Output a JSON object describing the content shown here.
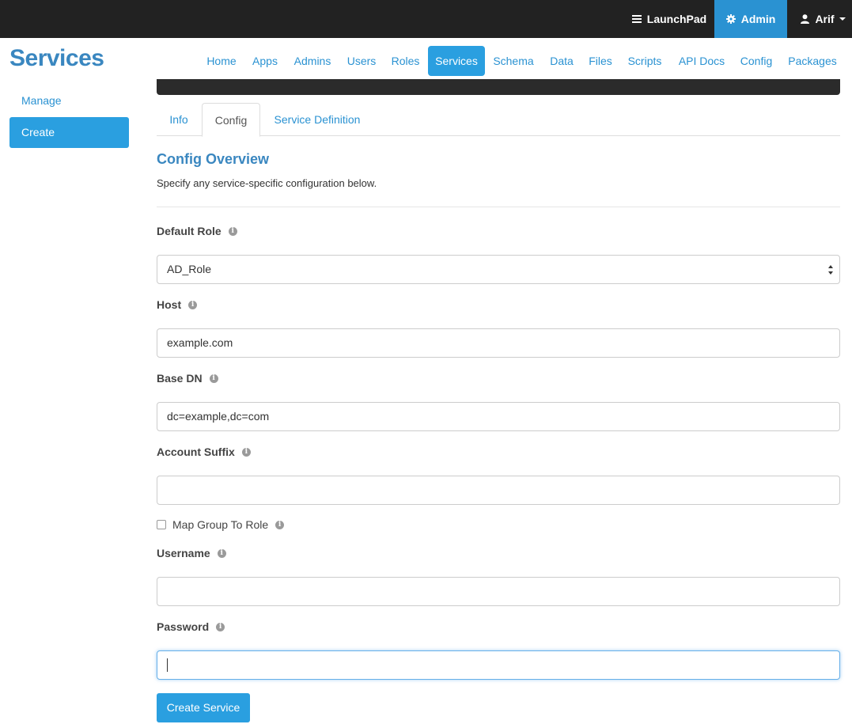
{
  "topbar": {
    "launchpad_label": "LaunchPad",
    "admin_label": "Admin",
    "user_label": "Arif"
  },
  "page_title": "Services",
  "nav": {
    "items": [
      {
        "label": "Home"
      },
      {
        "label": "Apps"
      },
      {
        "label": "Admins"
      },
      {
        "label": "Users"
      },
      {
        "label": "Roles"
      },
      {
        "label": "Services"
      },
      {
        "label": "Schema"
      },
      {
        "label": "Data"
      },
      {
        "label": "Files"
      },
      {
        "label": "Scripts"
      },
      {
        "label": "API Docs"
      },
      {
        "label": "Config"
      },
      {
        "label": "Packages"
      }
    ],
    "active": "Services"
  },
  "sidebar": {
    "manage_label": "Manage",
    "create_label": "Create"
  },
  "tabs": {
    "info": "Info",
    "config": "Config",
    "service_definition": "Service Definition",
    "active": "Config"
  },
  "config": {
    "title": "Config Overview",
    "description": "Specify any service-specific configuration below.",
    "default_role": {
      "label": "Default Role",
      "value": "AD_Role"
    },
    "host": {
      "label": "Host",
      "value": "example.com"
    },
    "base_dn": {
      "label": "Base DN",
      "value": "dc=example,dc=com"
    },
    "account_suffix": {
      "label": "Account Suffix",
      "value": ""
    },
    "map_group_to_role": {
      "label": "Map Group To Role",
      "checked": false
    },
    "username": {
      "label": "Username",
      "value": ""
    },
    "password": {
      "label": "Password",
      "value": ""
    },
    "submit_label": "Create Service"
  },
  "colors": {
    "accent": "#2a9fe0",
    "topbar": "#222222",
    "title": "#3a87c0"
  }
}
